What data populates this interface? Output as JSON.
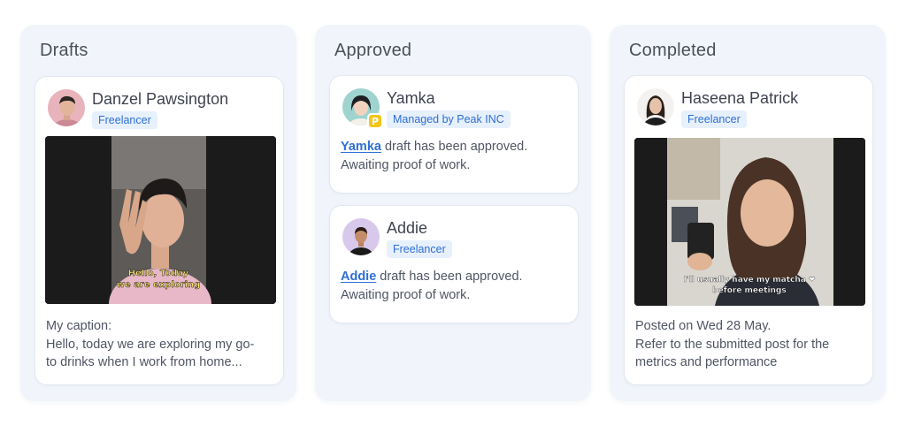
{
  "columns": {
    "drafts": {
      "title": "Drafts",
      "card": {
        "name": "Danzel Pawsington",
        "badge": "Freelancer",
        "video_caption_lines": [
          "Hello, Today",
          "we are exploring"
        ],
        "body_lines": [
          "My caption:",
          "Hello, today we are exploring my go-",
          "to drinks when I work from home..."
        ]
      }
    },
    "approved": {
      "title": "Approved",
      "cards": [
        {
          "name": "Yamka",
          "badge": "Managed by Peak INC",
          "agency_icon_letter": "P",
          "link_name": "Yamka",
          "message_rest": " draft has been approved.",
          "message_line2": "Awaiting proof of work."
        },
        {
          "name": "Addie",
          "badge": "Freelancer",
          "link_name": "Addie",
          "message_rest": " draft has been approved.",
          "message_line2": "Awaiting proof of work."
        }
      ]
    },
    "completed": {
      "title": "Completed",
      "card": {
        "name": "Haseena Patrick",
        "badge": "Freelancer",
        "video_caption_lines": [
          "I'll usually have my matcha ❤",
          "before meetings"
        ],
        "body_lines": [
          "Posted on Wed 28 May.",
          "Refer to the submitted post for the",
          "metrics and performance"
        ]
      }
    }
  },
  "colors": {
    "accent": "#2f6fd6",
    "badge_bg": "#e7f0fd",
    "column_bg": "#f1f5fb",
    "agency_badge": "#f5c518"
  }
}
